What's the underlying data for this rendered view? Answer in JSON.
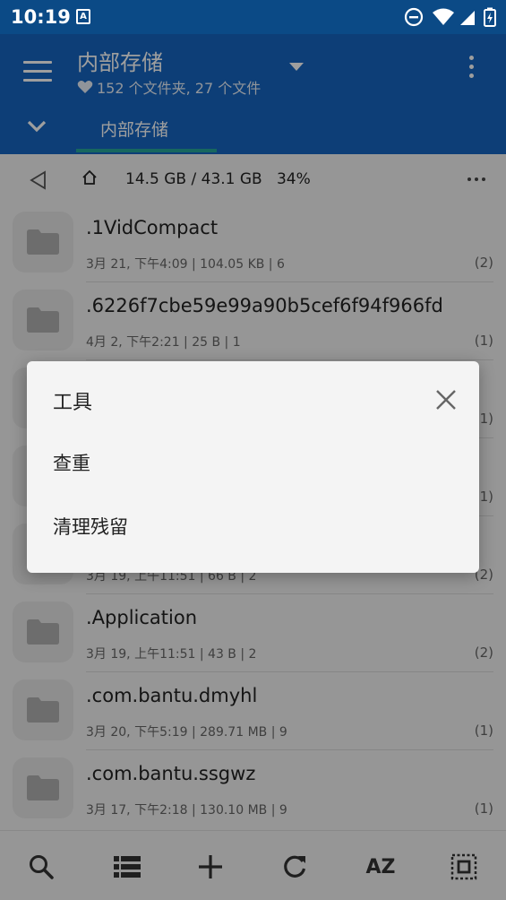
{
  "status_bar": {
    "time": "10:19",
    "notification_letter": "A",
    "icons": [
      "dnd-icon",
      "wifi-icon",
      "signal-icon",
      "battery-charging-icon"
    ]
  },
  "app_bar": {
    "title": "内部存储",
    "subtitle": "152 个文件夹, 27 个文件",
    "tab": "内部存储",
    "colors": {
      "primary": "#1565c0",
      "status": "#0b4a86",
      "accent": "#26a69a"
    }
  },
  "path_bar": {
    "storage": "14.5 GB / 43.1 GB",
    "percent": "34%"
  },
  "files": [
    {
      "name": ".1VidCompact",
      "meta": "3月 21, 下午4:09 | 104.05  KB | 6",
      "count": "(2)"
    },
    {
      "name": ".6226f7cbe59e99a90b5cef6f94f966fd",
      "meta": "4月 2, 下午2:21 | 25 B | 1",
      "count": "(1)"
    },
    {
      "name": "",
      "meta": "",
      "count": "(1)"
    },
    {
      "name": "",
      "meta": "",
      "count": "(1)"
    },
    {
      "name": "",
      "meta": "3月 19, 上午11:51 | 66 B | 2",
      "count": "(2)"
    },
    {
      "name": ".Application",
      "meta": "3月 19, 上午11:51 | 43 B | 2",
      "count": "(2)"
    },
    {
      "name": ".com.bantu.dmyhl",
      "meta": "3月 20, 下午5:19 | 289.71 MB | 9",
      "count": "(1)"
    },
    {
      "name": ".com.bantu.ssgwz",
      "meta": "3月 17, 下午2:18 | 130.10 MB | 9",
      "count": "(1)"
    }
  ],
  "bottom_bar": {
    "sort_label": "AZ",
    "icons": [
      "search-icon",
      "list-view-icon",
      "add-icon",
      "refresh-icon",
      "sort-icon",
      "select-all-icon"
    ]
  },
  "dialog": {
    "title": "工具",
    "items": [
      "查重",
      "清理残留"
    ]
  }
}
